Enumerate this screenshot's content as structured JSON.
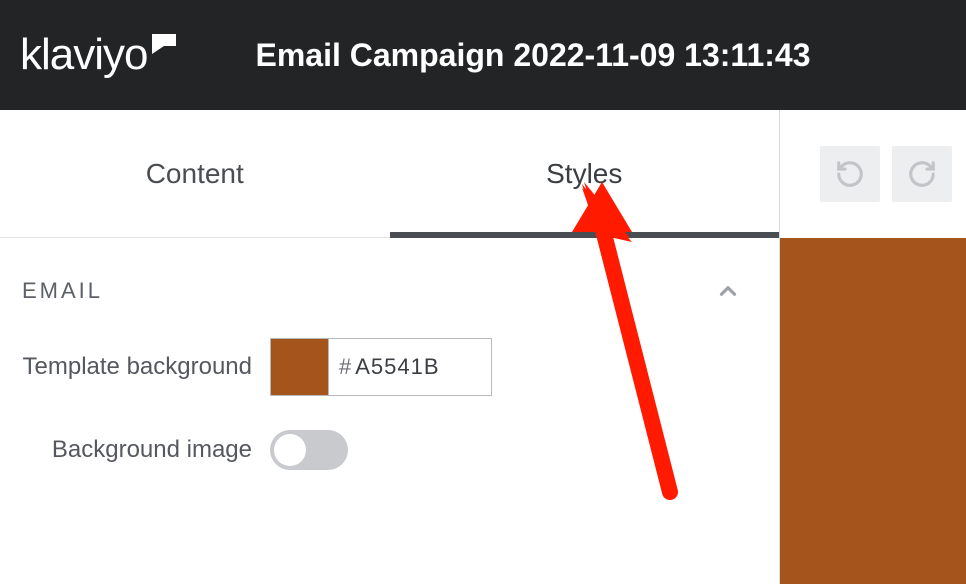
{
  "header": {
    "brand": "klaviyo",
    "title": "Email Campaign 2022-11-09 13:11:43"
  },
  "tabs": {
    "content": "Content",
    "styles": "Styles"
  },
  "section": {
    "title": "EMAIL"
  },
  "fields": {
    "template_bg_label": "Template background",
    "template_bg_hash": "#",
    "template_bg_hex": "A5541B",
    "template_bg_color": "#a5541b",
    "bg_image_label": "Background image"
  }
}
